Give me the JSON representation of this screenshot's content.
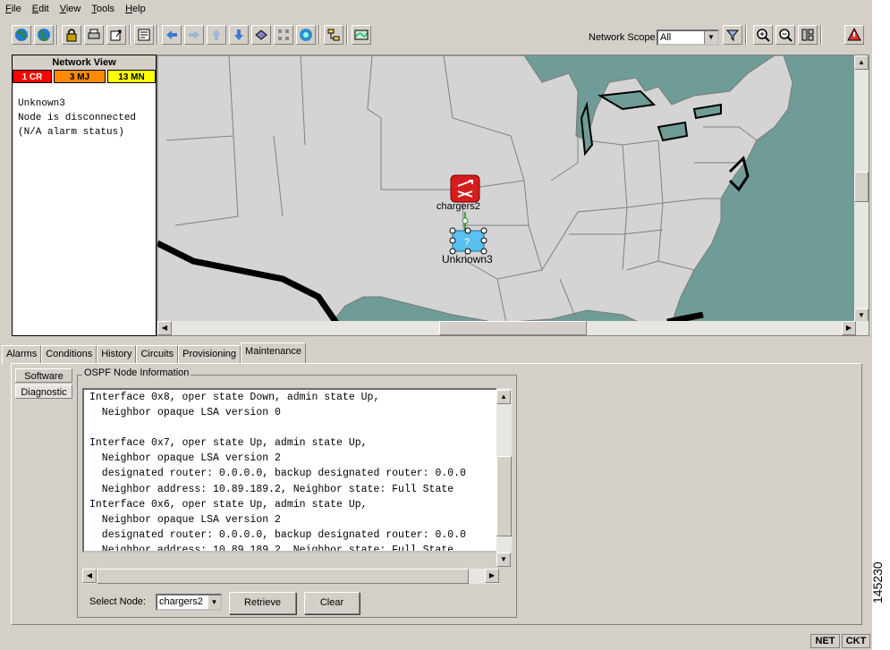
{
  "menu": [
    "File",
    "Edit",
    "View",
    "Tools",
    "Help"
  ],
  "toolbar": {
    "scope_label": "Network Scope:",
    "scope_value": "All",
    "icons": [
      "globe-icon",
      "globe-alt-icon",
      "lock-icon",
      "print-icon",
      "export-icon",
      "properties-icon",
      "back-arrow-icon",
      "forward-arrow-icon",
      "up-arrow-icon",
      "down-arrow-icon",
      "home-node-icon",
      "network-icon",
      "web-icon",
      "tree-icon",
      "map-icon"
    ],
    "right_icons": [
      "filter-icon",
      "zoom-in-icon",
      "zoom-out-icon",
      "layout-icon",
      "alarm-warning-icon"
    ]
  },
  "network_view": {
    "title": "Network View",
    "alarms": [
      {
        "label": "1 CR",
        "color": "#ff0000",
        "text_color": "#ffffff"
      },
      {
        "label": "3 MJ",
        "color": "#ff8a00",
        "text_color": "#000000"
      },
      {
        "label": "13 MN",
        "color": "#ffff00",
        "text_color": "#000000"
      }
    ],
    "node_info": "Unknown3\nNode is disconnected\n(N/A alarm status)"
  },
  "map": {
    "node_label_top": "chargers2",
    "node_label_bottom": "Unknown3",
    "unknown_glyph": "?"
  },
  "tabs": [
    "Alarms",
    "Conditions",
    "History",
    "Circuits",
    "Provisioning",
    "Maintenance"
  ],
  "active_tab": "Maintenance",
  "subtabs": [
    "Software",
    "Diagnostic"
  ],
  "ospf": {
    "group_title": "OSPF Node Information",
    "text": "Interface 0x8, oper state Down, admin state Up,\n  Neighbor opaque LSA version 0\n\nInterface 0x7, oper state Up, admin state Up,\n  Neighbor opaque LSA version 2\n  designated router: 0.0.0.0, backup designated router: 0.0.0\n  Neighbor address: 10.89.189.2, Neighbor state: Full State\nInterface 0x6, oper state Up, admin state Up,\n  Neighbor opaque LSA version 2\n  designated router: 0.0.0.0, backup designated router: 0.0.0\n  Neighbor address: 10.89.189.2, Neighbor state: Full State",
    "select_label": "Select Node:",
    "select_value": "chargers2",
    "retrieve_label": "Retrieve",
    "clear_label": "Clear"
  },
  "status": {
    "net": "NET",
    "ckt": "CKT"
  },
  "figure_number": "145230"
}
